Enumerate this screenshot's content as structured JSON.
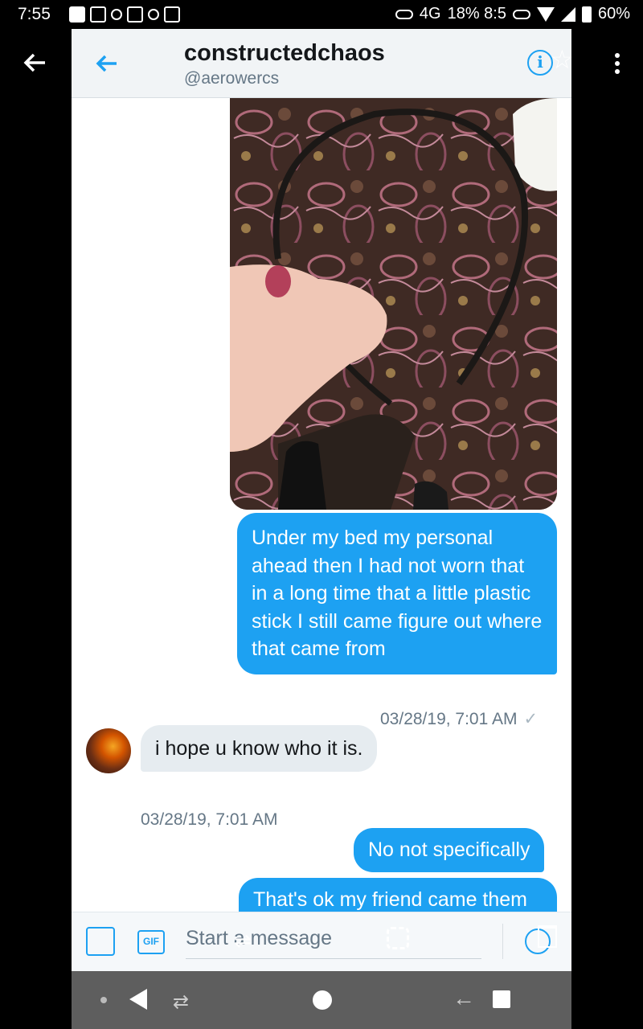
{
  "status_bar": {
    "time": "7:55",
    "right_text": "18% 8:5",
    "battery": "60%",
    "signal_label": "4G"
  },
  "header": {
    "title": "constructedchaos",
    "handle": "@aerowercs",
    "info_glyph": "i",
    "star_glyph": "☆",
    "back_icon": "arrow-left-icon",
    "accent_color": "#1da1f2"
  },
  "messages": {
    "photo_alt": "hand holding a black plastic headband over paisley fabric",
    "outgoing_1": "Under my bed my personal ahead then I had not worn that in a long time that a little plastic stick I still came figure out where that came from",
    "outgoing_1_time": "03/28/19, 7:01 AM",
    "outgoing_1_check": "✓",
    "incoming_1": "i hope u know who it is.",
    "incoming_1_time": "03/28/19, 7:01 AM",
    "outgoing_2": "No not specifically",
    "outgoing_3": "That's ok my friend came them"
  },
  "composer": {
    "placeholder": "Start a message",
    "gif_label": "GIF",
    "sliders_glyph": "⇌"
  },
  "nav": {
    "recent_glyph": "⇄",
    "left_arrow_glyph": "←"
  }
}
